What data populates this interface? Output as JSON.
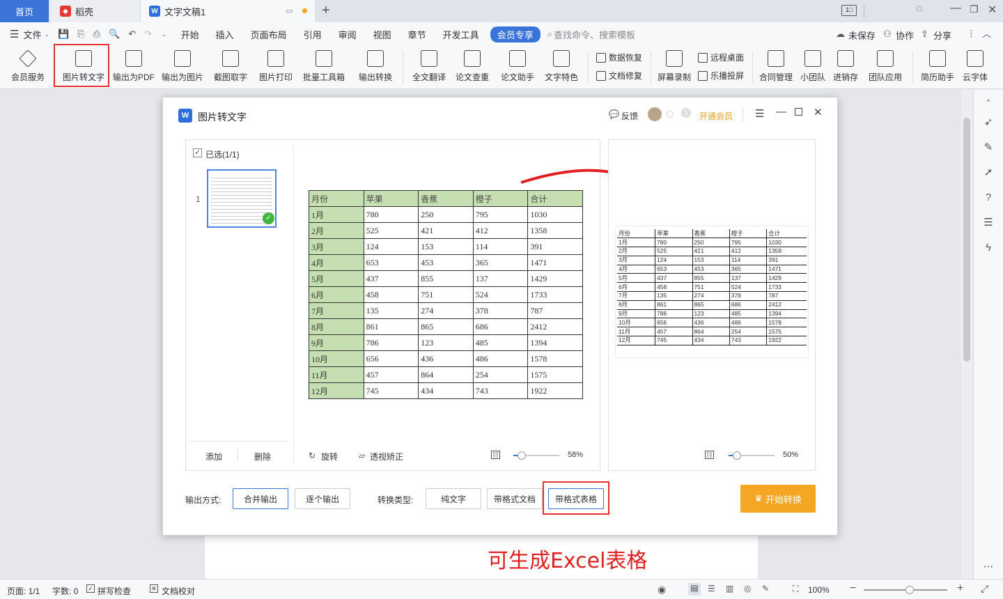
{
  "tabs": {
    "home": "首页",
    "docer": "稻壳",
    "doc": "文字文稿1"
  },
  "menu": {
    "file": "文件",
    "items": [
      "开始",
      "插入",
      "页面布局",
      "引用",
      "审阅",
      "视图",
      "章节",
      "开发工具"
    ],
    "member": "会员专享",
    "search": "查找命令、搜索模板",
    "unsaved": "未保存",
    "collab": "协作",
    "share": "分享"
  },
  "ribbon": {
    "buttons": [
      "会员服务",
      "图片转文字",
      "输出为PDF",
      "输出为图片",
      "截图取字",
      "图片打印",
      "批量工具箱",
      "输出转换",
      "全文翻译",
      "论文查重",
      "论文助手",
      "文字特色"
    ],
    "small": [
      "数据恢复",
      "文档修复",
      "远程桌面",
      "乐播投屏"
    ],
    "buttons2": [
      "屏幕录制",
      "合同管理",
      "小团队",
      "进销存",
      "团队应用",
      "简历助手",
      "云字体"
    ]
  },
  "dialog": {
    "title": "图片转文字",
    "feedback": "反馈",
    "vip": "开通会员",
    "selected": "已选(1/1)",
    "thumb_index": "1",
    "add": "添加",
    "delete": "删除",
    "rotate": "旋转",
    "perspective": "透视矫正",
    "zoom_left": "58%",
    "zoom_right": "50%",
    "output_label": "输出方式:",
    "output_options": [
      "合并输出",
      "逐个输出"
    ],
    "type_label": "转换类型:",
    "type_options": [
      "纯文字",
      "带格式文档",
      "带格式表格"
    ],
    "start": "开始转换"
  },
  "table": {
    "headers": [
      "月份",
      "苹果",
      "香蕉",
      "橙子",
      "合计"
    ],
    "rows": [
      [
        "1月",
        "780",
        "250",
        "795",
        "1030"
      ],
      [
        "2月",
        "525",
        "421",
        "412",
        "1358"
      ],
      [
        "3月",
        "124",
        "153",
        "114",
        "391"
      ],
      [
        "4月",
        "653",
        "453",
        "365",
        "1471"
      ],
      [
        "5月",
        "437",
        "855",
        "137",
        "1429"
      ],
      [
        "6月",
        "458",
        "751",
        "524",
        "1733"
      ],
      [
        "7月",
        "135",
        "274",
        "378",
        "787"
      ],
      [
        "8月",
        "861",
        "865",
        "686",
        "2412"
      ],
      [
        "9月",
        "786",
        "123",
        "485",
        "1394"
      ],
      [
        "10月",
        "656",
        "436",
        "486",
        "1578"
      ],
      [
        "11月",
        "457",
        "864",
        "254",
        "1575"
      ],
      [
        "12月",
        "745",
        "434",
        "743",
        "1922"
      ]
    ]
  },
  "annotation": "可生成Excel表格",
  "status": {
    "page": "页面: 1/1",
    "words": "字数: 0",
    "spell": "拼写检查",
    "proof": "文档校对",
    "zoom": "100%"
  }
}
